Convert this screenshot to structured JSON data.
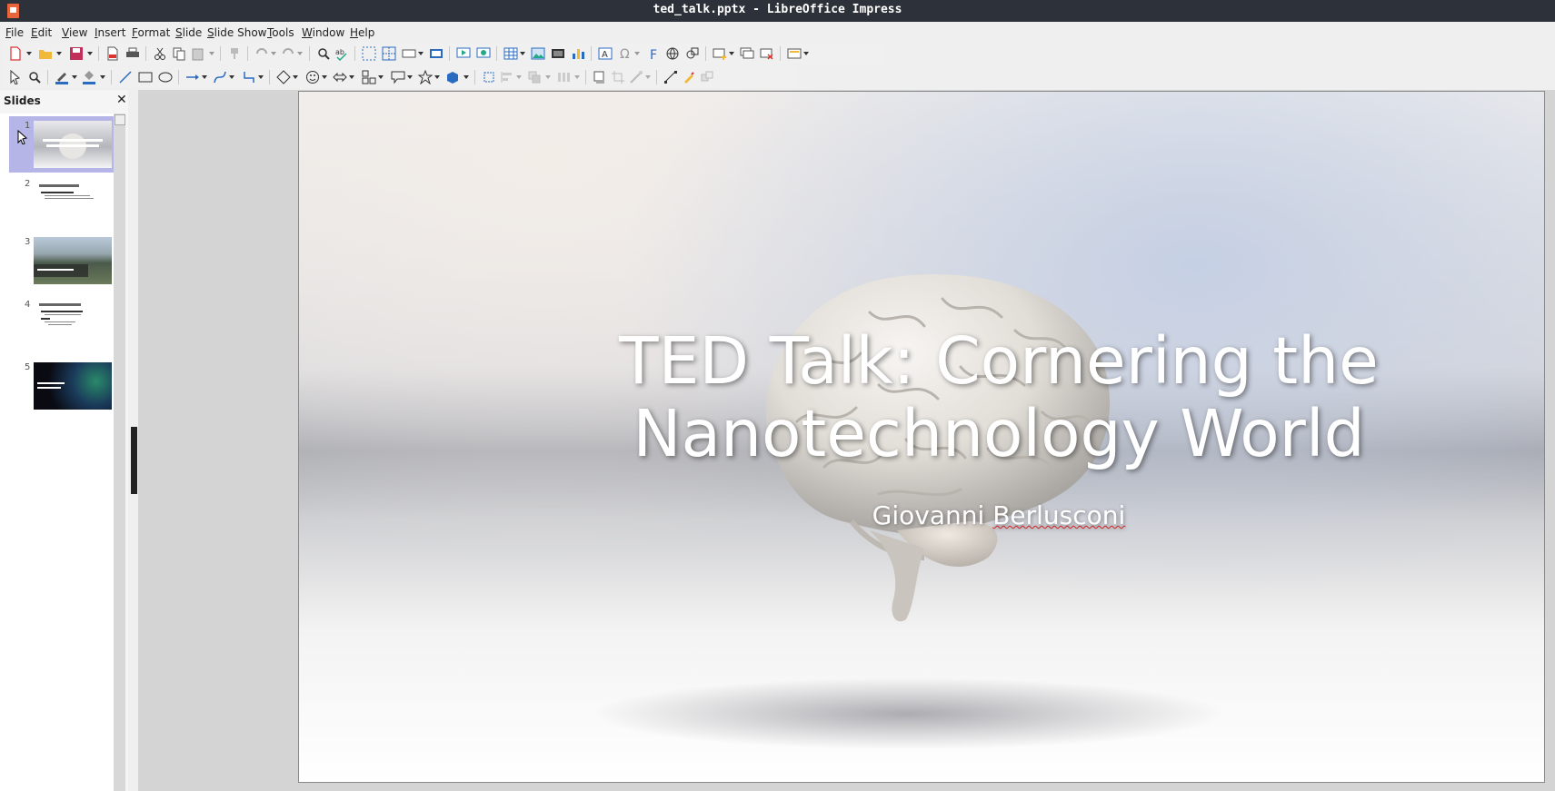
{
  "window": {
    "title": "ted_talk.pptx - LibreOffice Impress"
  },
  "menu": [
    "File",
    "Edit",
    "View",
    "Insert",
    "Format",
    "Slide",
    "Slide Show",
    "Tools",
    "Window",
    "Help"
  ],
  "slides_panel": {
    "title": "Slides",
    "slides": [
      {
        "number": "1",
        "selected": true,
        "title": "TED Talk: Cornering the Nanotechnology World"
      },
      {
        "number": "2",
        "selected": false,
        "title": "What is Nanotechnology"
      },
      {
        "number": "3",
        "selected": false,
        "title": "My Research Findings"
      },
      {
        "number": "4",
        "selected": false,
        "title": "A Corner of Nano Classics"
      },
      {
        "number": "5",
        "selected": false,
        "title": "The Future is in Our Hands"
      }
    ]
  },
  "slide": {
    "title_line1": "TED Talk: Cornering the",
    "title_line2": "Nanotechnology World",
    "subtitle_first": "Giovanni ",
    "subtitle_last": "Berlusconi"
  },
  "icons": [
    "new-icon",
    "open-icon",
    "save-icon",
    "export-pdf-icon",
    "print-icon",
    "cut-icon",
    "copy-icon",
    "paste-icon",
    "clone-icon",
    "undo-icon",
    "redo-icon",
    "find-icon",
    "spellcheck-icon",
    "grid-icon",
    "helplines-icon",
    "display-views-icon",
    "master-slide-icon",
    "start-presentation-icon",
    "start-current-icon",
    "table-icon",
    "image-icon",
    "media-icon",
    "chart-icon",
    "textbox-icon",
    "special-char-icon",
    "fontwork-icon",
    "hyperlink-icon",
    "draw-icon",
    "new-slide-icon",
    "duplicate-slide-icon",
    "delete-slide-icon",
    "slide-layout-icon",
    "select-icon",
    "zoom-icon",
    "line-color-icon",
    "fill-color-icon",
    "line-icon",
    "rectangle-icon",
    "ellipse-icon",
    "arrow-icon",
    "curve-icon",
    "connector-icon",
    "basic-shapes-icon",
    "symbol-shapes-icon",
    "block-arrows-icon",
    "flowchart-icon",
    "callouts-icon",
    "stars-icon",
    "3d-objects-icon",
    "rotate-icon",
    "align-icon",
    "arrange-icon",
    "distribute-icon",
    "shadow-icon",
    "crop-icon",
    "filter-icon",
    "points-icon",
    "glue-icon",
    "toggle-extrusion-icon"
  ]
}
